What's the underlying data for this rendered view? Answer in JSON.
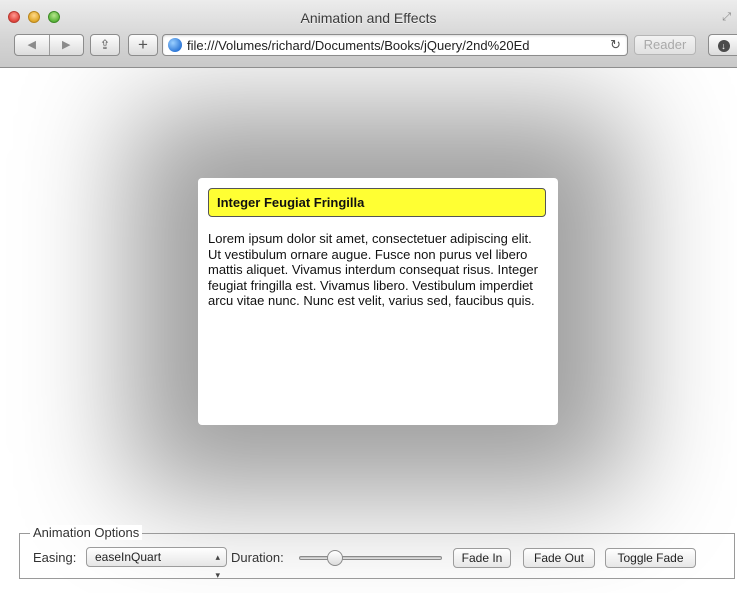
{
  "window": {
    "title": "Animation and Effects"
  },
  "toolbar": {
    "back_glyph": "◀",
    "forward_glyph": "▶",
    "share_glyph": "⇪",
    "new_tab_glyph": "+",
    "url": "file:///Volumes/richard/Documents/Books/jQuery/2nd%20Ed",
    "reload_glyph": "↻",
    "reader_label": "Reader",
    "download_glyph": "↓",
    "fullscreen_glyph": "⤢"
  },
  "dialog": {
    "title": "Integer Feugiat Fringilla",
    "body": "Lorem ipsum dolor sit amet, consectetuer adipiscing elit. Ut vestibulum ornare augue. Fusce non purus vel libero mattis aliquet. Vivamus interdum consequat risus. Integer feugiat fringilla est. Vivamus libero. Vestibulum imperdiet arcu vitae nunc. Nunc est velit, varius sed, faucibus quis.",
    "title_bg": "#ffff33"
  },
  "options": {
    "legend": "Animation Options",
    "easing_label": "Easing:",
    "easing_value": "easeInQuart",
    "duration_label": "Duration:",
    "duration_fraction": 0.22,
    "fade_in": "Fade In",
    "fade_out": "Fade Out",
    "toggle_fade": "Toggle Fade"
  }
}
